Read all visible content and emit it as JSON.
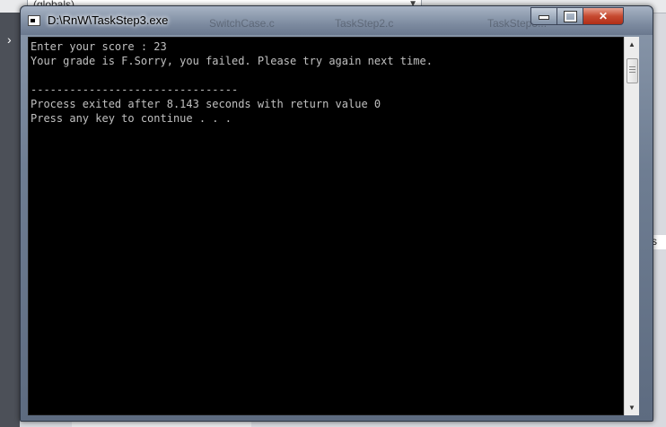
{
  "background": {
    "globals_dropdown": "(globals)",
    "tabs": [
      "SwitchCase.c",
      "TaskStep2.c",
      "TaskStep3..."
    ],
    "right_edge_text": "s"
  },
  "window": {
    "title": "D:\\RnW\\TaskStep3.exe",
    "icon": "console-app-icon",
    "controls": {
      "minimize_icon": "minimize-icon",
      "maximize_icon": "maximize-icon",
      "close_glyph": "✕"
    }
  },
  "console": {
    "lines": [
      "Enter your score : 23",
      "Your grade is F.Sorry, you failed. Please try again next time.",
      "",
      "--------------------------------",
      "Process exited after 8.143 seconds with return value 0",
      "Press any key to continue . . ."
    ]
  },
  "scrollbar": {
    "up_glyph": "▲",
    "down_glyph": "▼"
  }
}
